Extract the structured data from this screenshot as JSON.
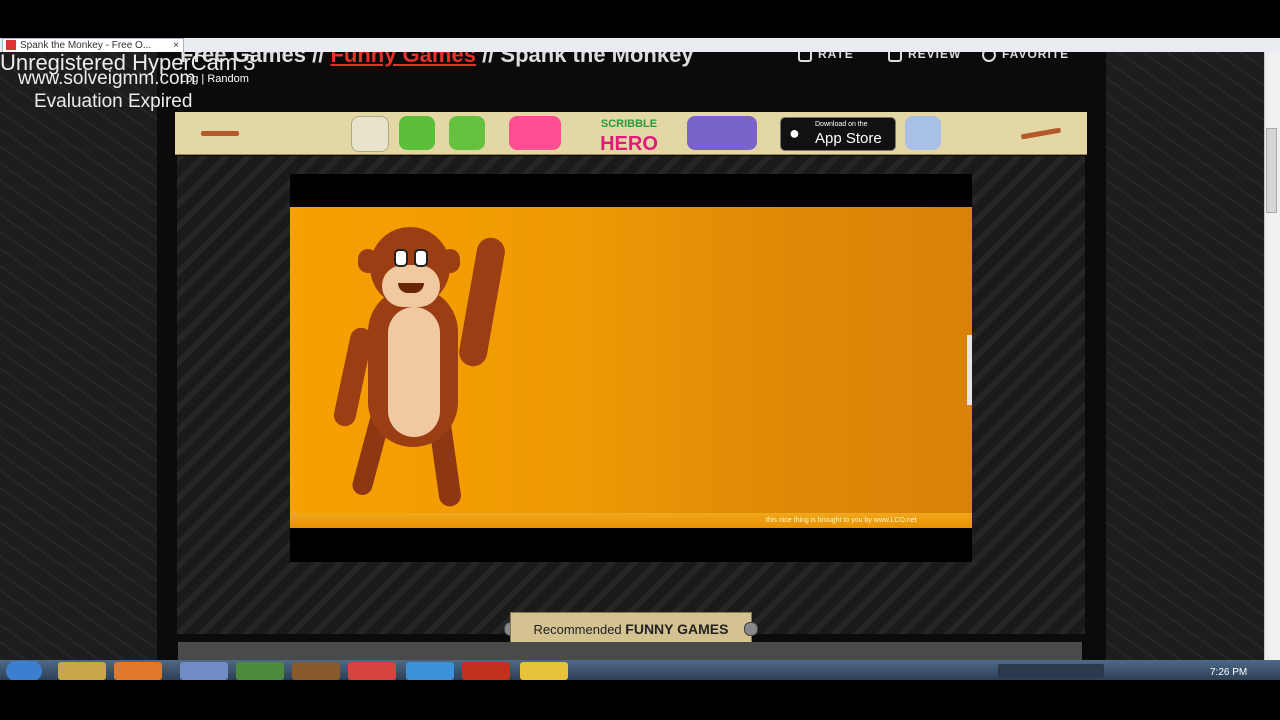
{
  "browser": {
    "tab_title": "Spank the Monkey - Free O...",
    "tab_close": "×"
  },
  "watermark": {
    "line1": "Unregistered HyperCam 3",
    "line2": "www.solveigmm.com",
    "line3": "Evaluation Expired",
    "small": "Log | Random"
  },
  "header": {
    "site": "Free Games",
    "separator": "//",
    "category": "Funny Games",
    "game_title": "Spank the Monkey",
    "actions": [
      {
        "label": "RATE",
        "icon": "thumb-up-icon"
      },
      {
        "label": "REVIEW",
        "icon": "pencil-icon"
      },
      {
        "label": "FAVORITE",
        "icon": "heart-icon"
      }
    ]
  },
  "banner": {
    "scribble_line1": "SCRIBBLE",
    "scribble_line2": "HERO",
    "appstore_small": "Download on the",
    "appstore_big": "App Store"
  },
  "game": {
    "credit": "this nice thing is brought to you by www.LCO.net"
  },
  "recommended": {
    "prefix": "Recommended",
    "bold": "FUNNY GAMES"
  },
  "taskbar": {
    "clock": "7:26 PM",
    "apps": [
      "explorer",
      "media-player",
      "paint",
      "minecraft",
      "game",
      "chrome",
      "internet-explorer",
      "hypercam",
      "security"
    ]
  },
  "colors": {
    "accent_link": "#e4322b",
    "stage_orange": "#f7a000",
    "banner_bg": "#e3d7a6"
  }
}
